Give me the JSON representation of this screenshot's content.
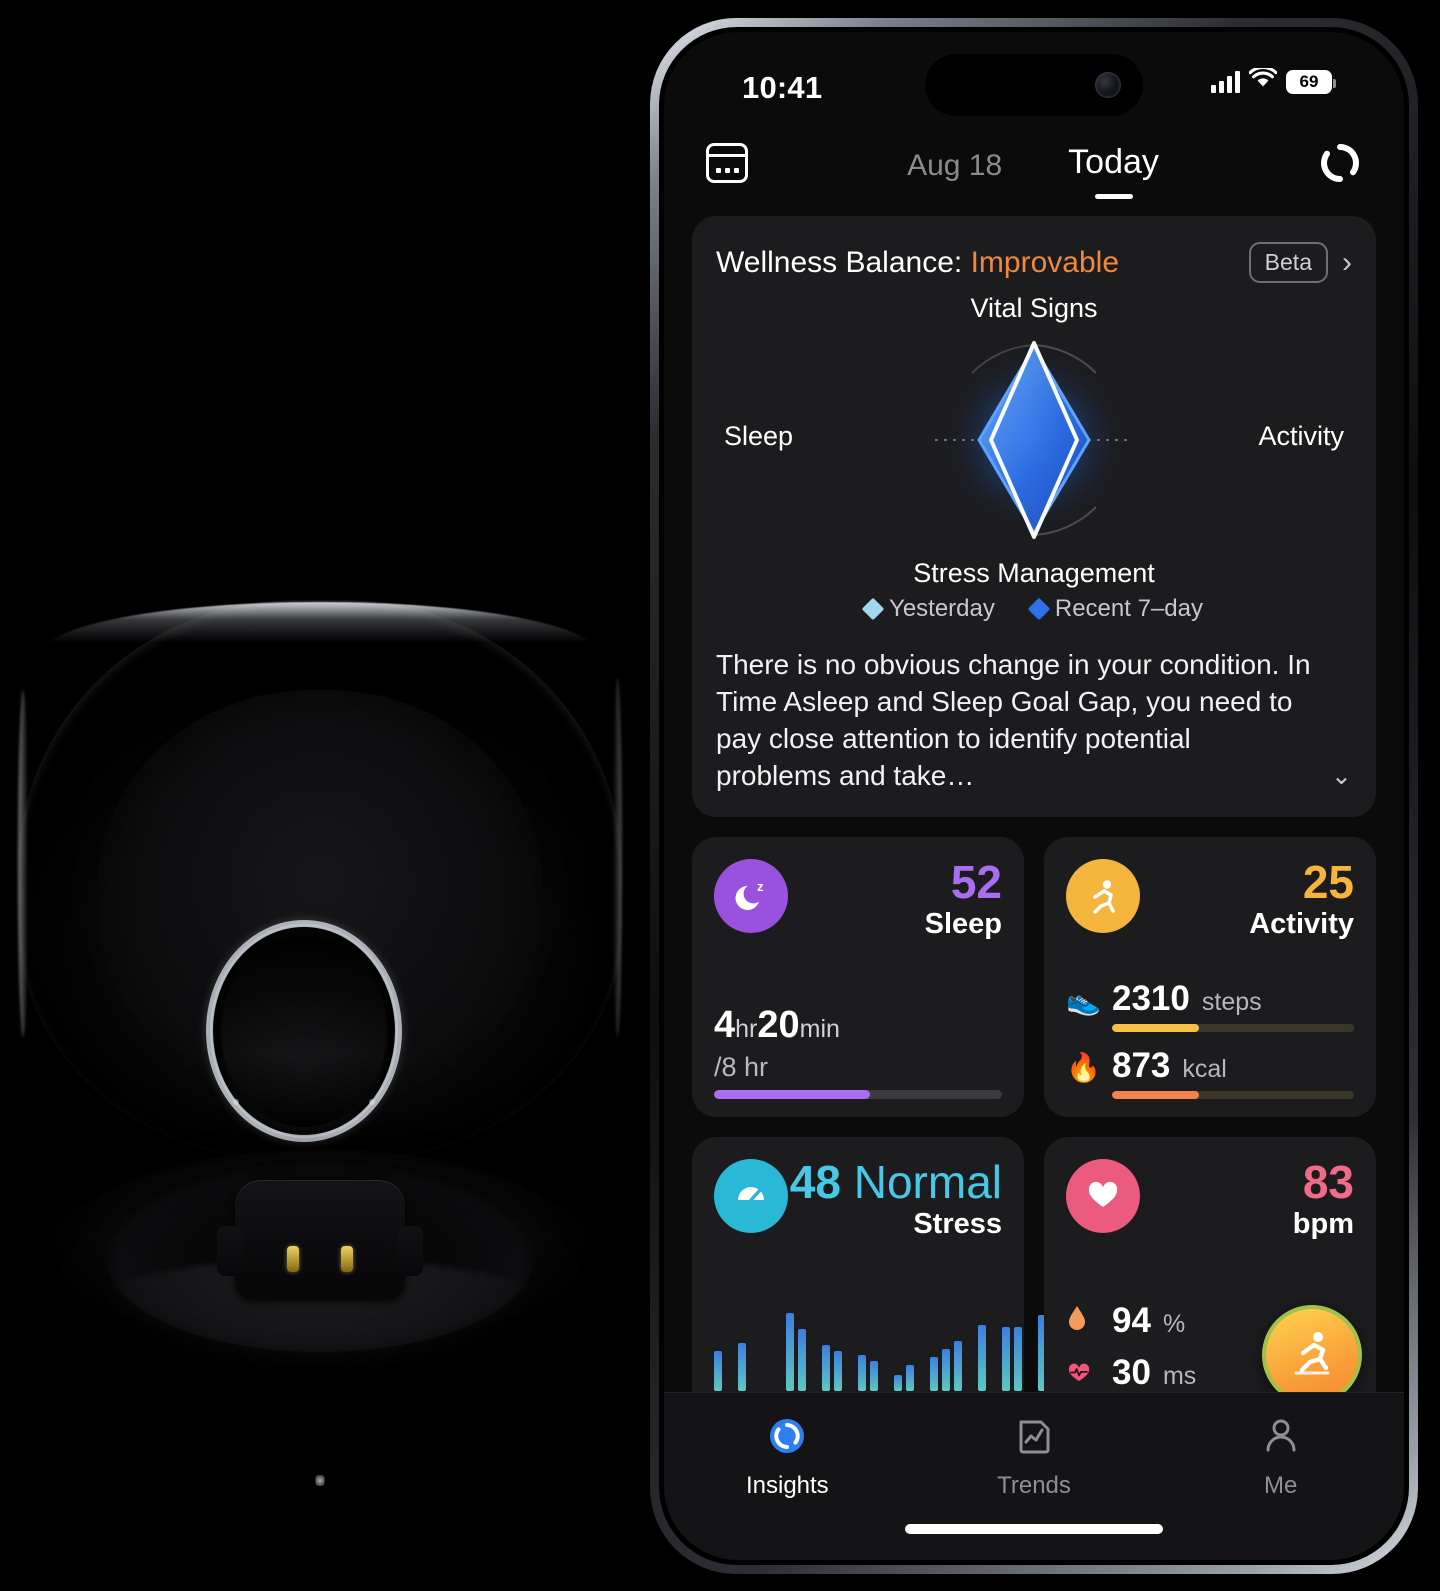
{
  "product": {
    "name": "smart-ring-charging-case",
    "parts": [
      "case-lid",
      "smart-ring",
      "charging-dock",
      "charging-pins",
      "status-led"
    ]
  },
  "phone": {
    "status_bar": {
      "time": "10:41",
      "signal_icon": "cellular-signal-icon",
      "wifi_icon": "wifi-icon",
      "battery_level": "69",
      "battery_icon": "battery-icon"
    },
    "nav": {
      "calendar_icon": "calendar-icon",
      "prev_date": "Aug 18",
      "current_date": "Today",
      "sync_icon": "sync-icon"
    }
  },
  "wellness": {
    "title_prefix": "Wellness Balance:",
    "status": "Improvable",
    "status_color": "#f0883e",
    "beta_label": "Beta",
    "chevron_icon": "chevron-right-icon",
    "description": "There is no obvious change in your condition. In Time Asleep and Sleep Goal Gap, you need to pay close attention to identify potential problems and take…",
    "expand_icon": "chevron-down-icon",
    "legend": [
      {
        "label": "Yesterday",
        "color": "#9fd8ef"
      },
      {
        "label": "Recent 7–day",
        "color": "#2f6fe8"
      }
    ]
  },
  "chart_data": {
    "type": "radar",
    "title": "Wellness Balance",
    "axes": [
      "Vital Signs",
      "Activity",
      "Stress Management",
      "Sleep"
    ],
    "axis_order_clockwise": [
      "Vital Signs",
      "Activity",
      "Stress Management",
      "Sleep"
    ],
    "series": [
      {
        "name": "Yesterday",
        "color": "#eaf4ff",
        "values": [
          0.95,
          0.46,
          0.95,
          0.46
        ]
      },
      {
        "name": "Recent 7–day",
        "color": "#2f6fe8",
        "values": [
          0.88,
          0.55,
          0.88,
          0.55
        ]
      }
    ],
    "rmax": 1,
    "grid": false,
    "legend_position": "bottom"
  },
  "tiles": {
    "sleep": {
      "icon": "sleep-moon-icon",
      "icon_bg": "#9b51e0",
      "score": "52",
      "score_color": "#a96ef0",
      "name": "Sleep",
      "duration_hours": "4",
      "hours_unit": "hr",
      "duration_minutes": "20",
      "minutes_unit": "min",
      "goal": "/8 hr",
      "progress_pct": 54,
      "bar_color": "#a96ef0"
    },
    "activity": {
      "icon": "running-person-icon",
      "icon_bg": "#f5b43c",
      "score": "25",
      "score_color": "#f5b43c",
      "name": "Activity",
      "rows": [
        {
          "icon": "shoe-icon",
          "glyph": "👟",
          "value": "2310",
          "unit": "steps",
          "progress_pct": 36,
          "bar_color": "#f5c144"
        },
        {
          "icon": "flame-icon",
          "glyph": "🔥",
          "value": "873",
          "unit": "kcal",
          "progress_pct": 36,
          "bar_color": "#f3834b"
        }
      ]
    },
    "stress": {
      "icon": "stress-gauge-icon",
      "icon_bg": "#29b8d6",
      "score": "48",
      "level": "Normal",
      "score_color": "#48c8e6",
      "name": "Stress",
      "chart": {
        "type": "bar",
        "values": [
          40,
          0,
          48,
          0,
          0,
          0,
          78,
          62,
          0,
          46,
          40,
          0,
          36,
          30,
          0,
          16,
          26,
          0,
          34,
          42,
          50,
          0,
          66,
          0,
          64,
          64,
          0,
          76
        ],
        "empty_slots": 24,
        "ymax": 80,
        "gradient_from": "#3e7ee0",
        "gradient_to": "#7fe0b0"
      }
    },
    "heart": {
      "icon": "heart-icon",
      "icon_bg": "#ec5a7d",
      "score": "83",
      "score_color": "#f06a8a",
      "name": "bpm",
      "rows": [
        {
          "icon": "blood-oxygen-drop-icon",
          "glyph": "🔸",
          "value": "94",
          "unit": "%"
        },
        {
          "icon": "hrv-heartbeat-icon",
          "glyph": "💗",
          "value": "30",
          "unit": "ms"
        }
      ],
      "fab_icon": "workout-running-icon"
    }
  },
  "tabbar": {
    "items": [
      {
        "label": "Insights",
        "icon": "insights-ring-icon",
        "active": true
      },
      {
        "label": "Trends",
        "icon": "trends-chart-icon",
        "active": false
      },
      {
        "label": "Me",
        "icon": "profile-person-icon",
        "active": false
      }
    ]
  }
}
